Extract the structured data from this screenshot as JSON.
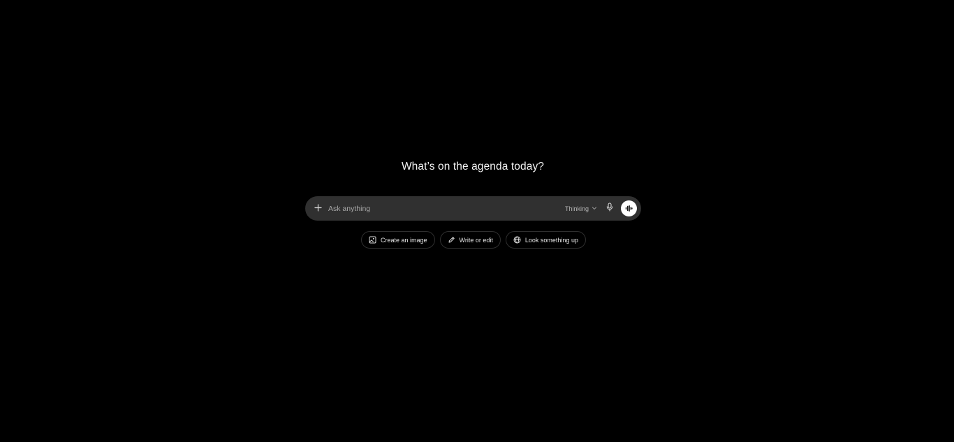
{
  "main": {
    "heading": "What’s on the agenda today?"
  },
  "composer": {
    "placeholder": "Ask anything",
    "add_icon": "plus-icon",
    "model_label": "Thinking",
    "model_icon": "chevron-down-icon",
    "mic_icon": "microphone-icon",
    "voice_icon": "voice-waveform-icon"
  },
  "suggestions": [
    {
      "label": "Create an image",
      "icon": "image-icon"
    },
    {
      "label": "Write or edit",
      "icon": "pencil-icon"
    },
    {
      "label": "Look something up",
      "icon": "globe-icon"
    }
  ],
  "colors": {
    "background": "#000000",
    "composer_bg": "#303030",
    "chip_border": "#2f2f2f",
    "voice_button": "#ffffff"
  }
}
